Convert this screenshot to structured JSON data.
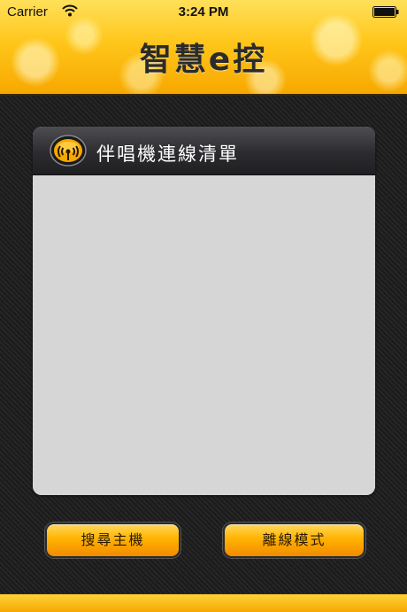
{
  "status_bar": {
    "carrier": "Carrier",
    "time": "3:24 PM",
    "wifi_icon": "wifi-icon",
    "battery_icon": "battery-icon"
  },
  "header": {
    "title": "智慧e控"
  },
  "panel": {
    "title": "伴唱機連線清單",
    "icon": "wireless-signal-icon",
    "devices": []
  },
  "buttons": {
    "search_host": "搜尋主機",
    "offline_mode": "離線模式"
  },
  "colors": {
    "header_yellow": "#ffc61a",
    "button_orange": "#ffb300",
    "panel_header_dark": "#2c2c30",
    "panel_body_gray": "#d6d6d6"
  }
}
